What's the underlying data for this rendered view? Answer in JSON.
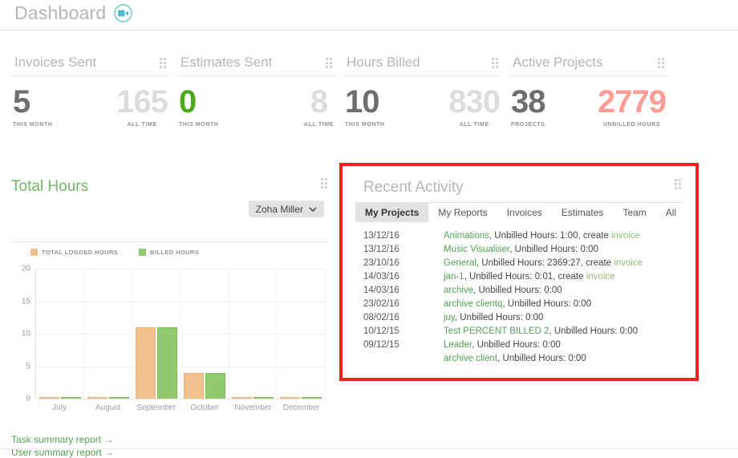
{
  "header": {
    "title": "Dashboard",
    "video_icon": "video-camera-icon",
    "accent_teal": "#8fd0da"
  },
  "stats": {
    "cards": [
      {
        "title": "Invoices Sent",
        "values": [
          {
            "num": "5",
            "label": "THIS MONTH",
            "style": "dark"
          },
          {
            "num": "165",
            "label": "ALL TIME",
            "style": "light"
          }
        ]
      },
      {
        "title": "Estimates Sent",
        "values": [
          {
            "num": "0",
            "label": "THIS MONTH",
            "style": "green"
          },
          {
            "num": "8",
            "label": "ALL TIME",
            "style": "light"
          }
        ]
      },
      {
        "title": "Hours Billed",
        "values": [
          {
            "num": "10",
            "label": "THIS MONTH",
            "style": "dark"
          },
          {
            "num": "830",
            "label": "ALL TIME",
            "style": "light"
          }
        ]
      },
      {
        "title": "Active Projects",
        "values": [
          {
            "num": "38",
            "label": "PROJECTS",
            "style": "dark"
          },
          {
            "num": "2779",
            "label": "UNBILLED HOURS",
            "style": "salmon"
          }
        ]
      }
    ],
    "colors": {
      "dark": "#6e6e6e",
      "light": "#dcdcdc",
      "green": "#4aa81c",
      "salmon": "#fb9d97"
    }
  },
  "total_hours": {
    "title": "Total Hours",
    "user_filter": "Zoha Miller",
    "links": [
      "Task summary report →",
      "User summary report →"
    ]
  },
  "chart_data": {
    "type": "bar",
    "title": "Total Hours",
    "categories": [
      "July",
      "August",
      "September",
      "October",
      "November",
      "December"
    ],
    "series": [
      {
        "name": "TOTAL LOGGED HOURS",
        "color": "#f2c28e",
        "values": [
          0,
          0,
          11,
          4,
          0,
          0
        ]
      },
      {
        "name": "BILLED HOURS",
        "color": "#91c96f",
        "values": [
          0,
          0,
          11,
          4,
          0,
          0
        ]
      }
    ],
    "xlabel": "",
    "ylabel": "",
    "ylim": [
      0,
      20
    ],
    "yticks": [
      0,
      5,
      10,
      15,
      20
    ],
    "grid": true,
    "legend_position": "top-left"
  },
  "recent_activity": {
    "title": "Recent Activity",
    "tabs": [
      {
        "label": "My Projects",
        "active": true
      },
      {
        "label": "My Reports",
        "active": false
      },
      {
        "label": "Invoices",
        "active": false
      },
      {
        "label": "Estimates",
        "active": false
      },
      {
        "label": "Team",
        "active": false
      },
      {
        "label": "All",
        "active": false
      }
    ],
    "rows": [
      {
        "date": "13/12/16",
        "project": "Animations",
        "middle": ", Unbilled Hours: 1:00, create ",
        "link": "invoice"
      },
      {
        "date": "13/12/16",
        "project": "Music Visualiser",
        "middle": ", Unbilled Hours: 0:00",
        "link": ""
      },
      {
        "date": "23/10/16",
        "project": "General",
        "middle": ", Unbilled Hours: 2369:27, create ",
        "link": "invoice"
      },
      {
        "date": "14/03/16",
        "project": "jan-1",
        "middle": ", Unbilled Hours: 0:01, create ",
        "link": "invoice"
      },
      {
        "date": "14/03/16",
        "project": "archive",
        "middle": ", Unbilled Hours: 0:00",
        "link": ""
      },
      {
        "date": "23/02/16",
        "project": "archive clientq",
        "middle": ", Unbilled Hours: 0:00",
        "link": ""
      },
      {
        "date": "08/02/16",
        "project": "juy",
        "middle": ", Unbilled Hours: 0:00",
        "link": ""
      },
      {
        "date": "10/12/15",
        "project": "Test PERCENT BILLED 2",
        "middle": ", Unbilled Hours: 0:00",
        "link": ""
      },
      {
        "date": "09/12/15",
        "project": "Leader",
        "middle": ", Unbilled Hours: 0:00",
        "link": ""
      },
      {
        "date": "",
        "project": "archive client",
        "middle": ", Unbilled Hours: 0:00",
        "link": ""
      }
    ],
    "highlight_color": "#e8241f"
  }
}
